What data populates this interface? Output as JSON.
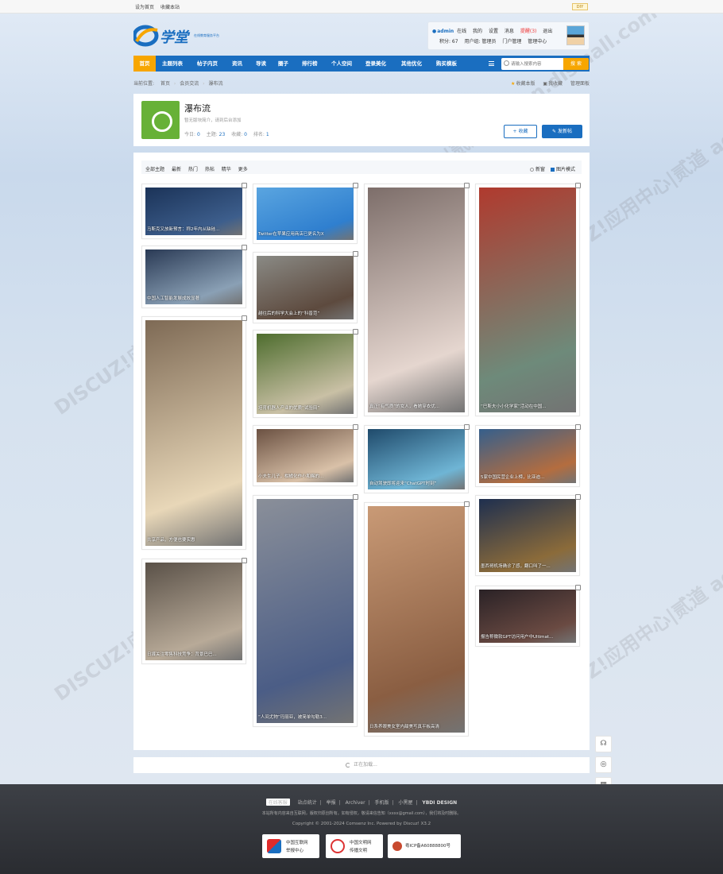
{
  "topbar": {
    "set_home": "设为首页",
    "bookmark": "收藏本站",
    "diy": "DIY"
  },
  "logo": {
    "name": "学堂",
    "slogan": "在线教育服务平台"
  },
  "user": {
    "name": "admin",
    "status": "在线",
    "my": "我的",
    "settings": "设置",
    "messages": "消息",
    "alerts": "提醒(3)",
    "logout": "退出",
    "points": "积分: 67",
    "group": "用户组: 管理员",
    "portal_admin": "门户管理",
    "admin_center": "管理中心"
  },
  "nav": {
    "items": [
      "首页",
      "主题列表",
      "帖子内页",
      "资讯",
      "导读",
      "圈子",
      "排行榜",
      "个人空间",
      "登录美化",
      "其他优化",
      "购买模板"
    ],
    "search_placeholder": "请输入搜索内容",
    "search_button": "搜 索"
  },
  "breadcrumb": {
    "label": "当前位置:",
    "items": [
      "首页",
      "会员交流",
      "瀑布流"
    ],
    "right": [
      "收藏本版",
      "我收藏",
      "管理面板"
    ]
  },
  "forum": {
    "title": "瀑布流",
    "desc": "暂无版块简介，请到后台添加",
    "stats": {
      "today_label": "今日:",
      "today": "0",
      "threads_label": "主题:",
      "threads": "23",
      "fav_label": "收藏:",
      "fav": "0",
      "rank_label": "排名:",
      "rank": "1"
    },
    "fav_button": "+ 收藏",
    "post_button": "发新帖"
  },
  "filter": {
    "left": [
      "全部主题",
      "最新",
      "热门",
      "热帖",
      "精华",
      "更多"
    ],
    "new_window": "新窗",
    "pic_mode": "图片模式"
  },
  "cards": [
    {
      "caption": "马斯克又放新预言：称2年内从缺硅...",
      "colors": [
        "#1b3358",
        "#3d5e8c"
      ]
    },
    {
      "caption": "中国人工智能发展成效显著",
      "colors": [
        "#2a3a55",
        "#8aa0b5"
      ]
    },
    {
      "caption": "共享产品，方便也要实惠",
      "colors": [
        "#7e6a55",
        "#e8d7b8"
      ]
    },
    {
      "caption": "日媒关注零售科技竞争：背景巴巴...",
      "colors": [
        "#5a5148",
        "#b8aa98"
      ]
    },
    {
      "caption": "Twitter在苹果应用商店已更名为X",
      "colors": [
        "#5aa5e0",
        "#2f7fcf"
      ]
    },
    {
      "caption": "越往后的科学大会上的“科普范”",
      "colors": [
        "#8a8a85",
        "#5d4a3e"
      ]
    },
    {
      "caption": "培育机器人产业的优质“试验田”",
      "colors": [
        "#4e6d2e",
        "#c9c0a5"
      ]
    },
    {
      "caption": "小夫生儿子，柑橘化作小和赐的...",
      "colors": [
        "#6b5142",
        "#d9c1a8"
      ]
    },
    {
      "caption": "“人间尤物”玛丽亚，被简单勾勒3...",
      "colors": [
        "#8a8f99",
        "#4b5d86"
      ]
    },
    {
      "caption": "真正“有气质”的女人，看她穿衣优...",
      "colors": [
        "#7d6e6a",
        "#e5d6cf"
      ]
    },
    {
      "caption": "自动驾驶即将迎来“ChatGPT时刻”",
      "colors": [
        "#1f4a6b",
        "#6fb5d5"
      ]
    },
    {
      "caption": "日系养眼美女室内甜美写真平板高清",
      "colors": [
        "#c99a76",
        "#8a5e42"
      ]
    },
    {
      "caption": "“巴斯夫小小化学家”活动在中国...",
      "colors": [
        "#b03a2e",
        "#6e8a7a"
      ]
    },
    {
      "caption": "5家中国民营企业上榜，比亚迪...",
      "colors": [
        "#355f8c",
        "#b46d3f"
      ]
    },
    {
      "caption": "墨西哥机场确诊了感，翻口叫了一...",
      "colors": [
        "#1e2f4f",
        "#8b6b3a"
      ]
    },
    {
      "caption": "报告称微软GPT访问用户中Ultimat...",
      "colors": [
        "#2a2226",
        "#6a4a42"
      ]
    }
  ],
  "loading": "正在加载...",
  "footer": {
    "online": "在线客服",
    "links": [
      "站点统计",
      "举报",
      "Archiver",
      "手机版",
      "小黑屋",
      "YBDI DESIGN"
    ],
    "notice": "本站所有内容来自互联网，版权归原创所有。如有侵权，敬请来信告知（xxxx@gmail.com），我们将及时删除。",
    "copyright": "Copyright © 2001-2024 Comsenz Inc. Powered by Discuz! X3.2",
    "badges": [
      {
        "line1": "中国互联网",
        "line2": "举报中心"
      },
      {
        "line1": "中国文明网",
        "line2": "传播文明"
      },
      {
        "line1": "粤ICP备A60888800号",
        "line2": ""
      }
    ]
  },
  "watermark": "DISCUZ!应用中心|贰道 addon.dismall.com"
}
